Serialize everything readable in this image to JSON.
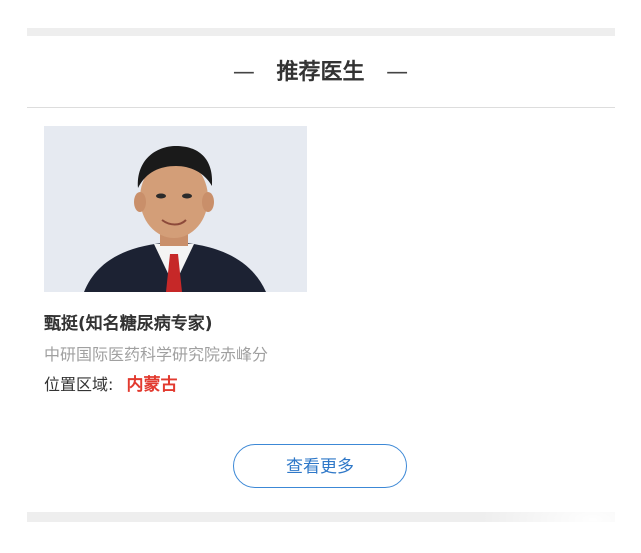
{
  "section": {
    "title": "推荐医生",
    "dash_left": "—",
    "dash_right": "—"
  },
  "doctor": {
    "name": "甄挺(知名糖尿病专家)",
    "hospital": "中研国际医药科学研究院赤峰分",
    "location_label": "位置区域:",
    "location_value": "内蒙古",
    "photo_icon": "doctor-portrait"
  },
  "actions": {
    "more_label": "查看更多"
  },
  "colors": {
    "accent_blue": "#3c88d6",
    "region_red": "#e23a2f",
    "muted_gray": "#a0a0a0"
  }
}
